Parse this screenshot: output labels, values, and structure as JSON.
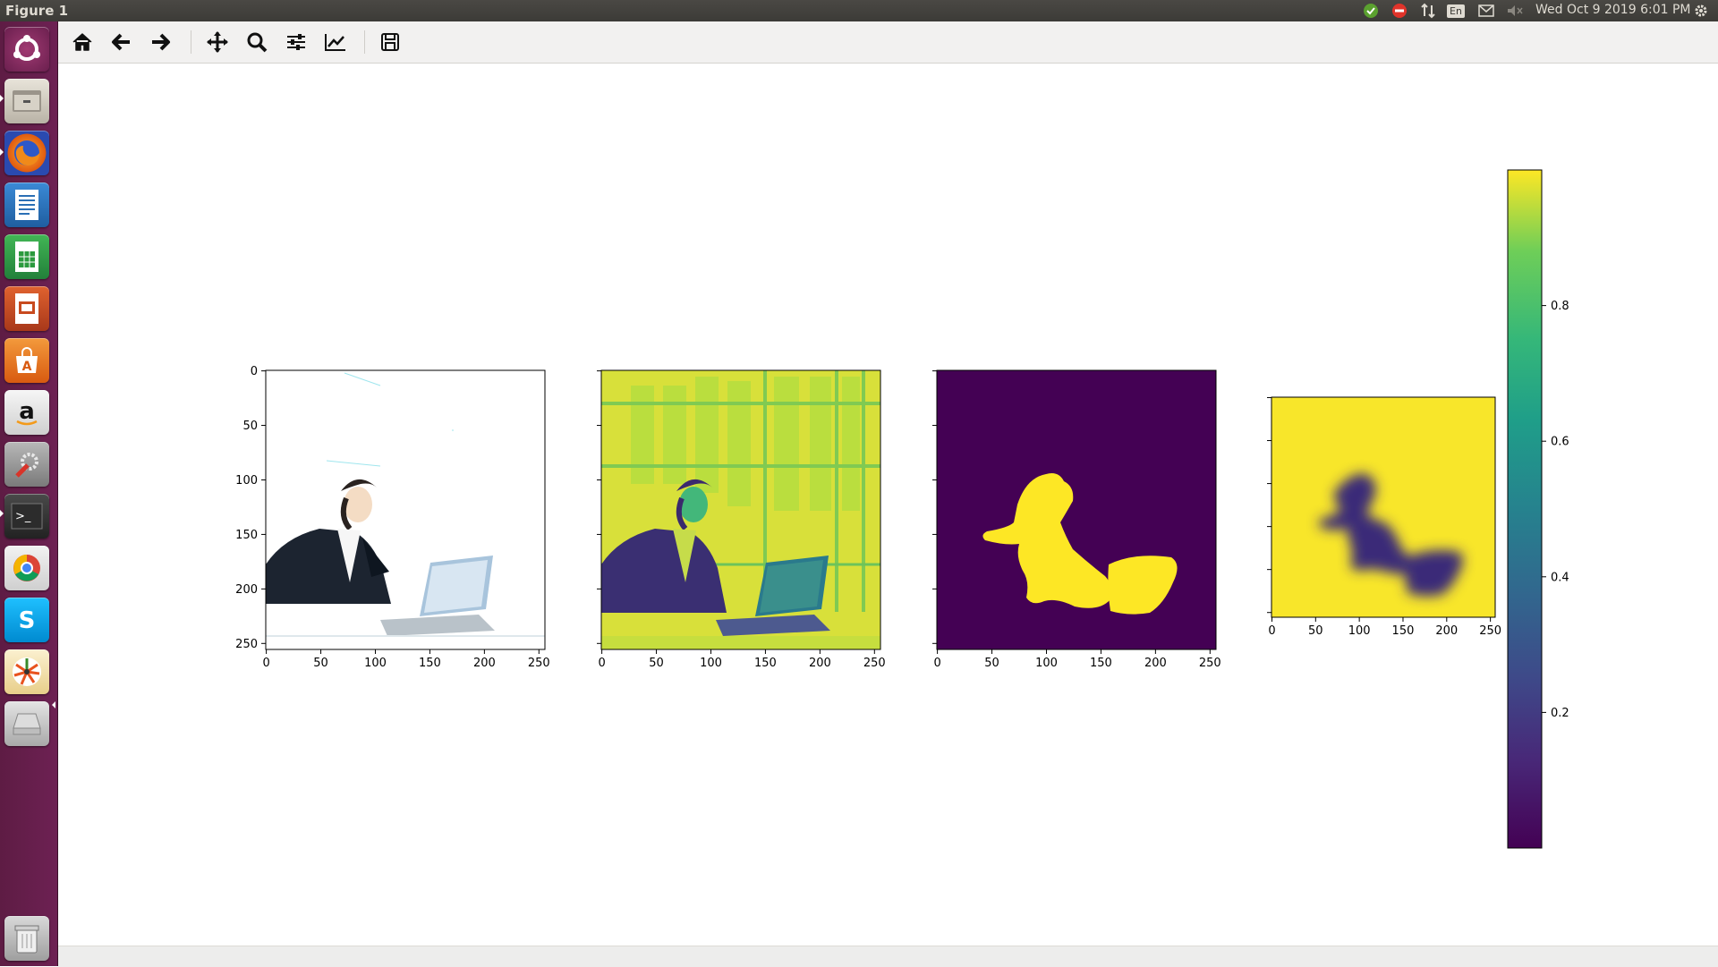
{
  "window": {
    "title": "Figure 1"
  },
  "system_tray": {
    "keyboard_layout": "En",
    "clock": "Wed Oct  9 2019  6:01 PM",
    "icons": [
      "update-ok-icon",
      "stop-icon",
      "network-icon",
      "keyboard-layout-icon",
      "mail-icon",
      "volume-muted-icon",
      "settings-gear-icon"
    ]
  },
  "launcher": {
    "items": [
      {
        "name": "ubuntu-dash-icon",
        "color": "#8a2a5e"
      },
      {
        "name": "files-icon",
        "color": "#d8d3c8"
      },
      {
        "name": "firefox-icon",
        "color": "#e66000"
      },
      {
        "name": "libreoffice-writer-icon",
        "color": "#2a6fb5"
      },
      {
        "name": "libreoffice-calc-icon",
        "color": "#2b9a3e"
      },
      {
        "name": "libreoffice-impress-icon",
        "color": "#c84a1f"
      },
      {
        "name": "software-center-icon",
        "color": "#e8731f"
      },
      {
        "name": "amazon-icon",
        "color": "#ececec"
      },
      {
        "name": "system-settings-icon",
        "color": "#9a9a9a"
      },
      {
        "name": "terminal-icon",
        "color": "#333333"
      },
      {
        "name": "chrome-icon",
        "color": "#e0e0e0"
      },
      {
        "name": "skype-icon",
        "color": "#00aff0"
      },
      {
        "name": "pinwheel-app-icon",
        "color": "#f4e3b0"
      },
      {
        "name": "drive-icon",
        "color": "#c8c8c8"
      }
    ],
    "trash": {
      "name": "trash-icon"
    }
  },
  "toolbar": {
    "buttons": [
      "home-icon",
      "back-icon",
      "forward-icon",
      "pan-icon",
      "zoom-icon",
      "subplots-icon",
      "edit-axis-icon",
      "save-icon"
    ]
  },
  "colors": {
    "viridis_low": "#440154",
    "viridis_mid": "#21918c",
    "viridis_high": "#fde725",
    "ubuntu_panel": "#3c3b37",
    "launcher_bg": "#6d2153"
  },
  "chart_data": [
    {
      "type": "heatmap",
      "content": "photo of woman working on laptop (RGB)",
      "xticks": [
        "0",
        "50",
        "100",
        "150",
        "200",
        "250"
      ],
      "yticks": [
        "0",
        "50",
        "100",
        "150",
        "200",
        "250"
      ]
    },
    {
      "type": "heatmap",
      "content": "single-channel photo rendered with viridis colormap",
      "xticks": [
        "0",
        "50",
        "100",
        "150",
        "200",
        "250"
      ],
      "yticks": []
    },
    {
      "type": "heatmap",
      "content": "binary segmentation mask (person and laptop)",
      "xticks": [
        "0",
        "50",
        "100",
        "150",
        "200",
        "250"
      ],
      "yticks": []
    },
    {
      "type": "heatmap",
      "content": "predicted soft mask, inverted, blurred",
      "xticks": [
        "0",
        "50",
        "100",
        "150",
        "200",
        "250"
      ],
      "yticks": []
    },
    {
      "type": "colorbar",
      "colormap": "viridis",
      "range": [
        0.0,
        1.0
      ],
      "ticks": [
        "0.8",
        "0.6",
        "0.4",
        "0.2"
      ],
      "tick_values": [
        0.8,
        0.6,
        0.4,
        0.2
      ]
    }
  ]
}
